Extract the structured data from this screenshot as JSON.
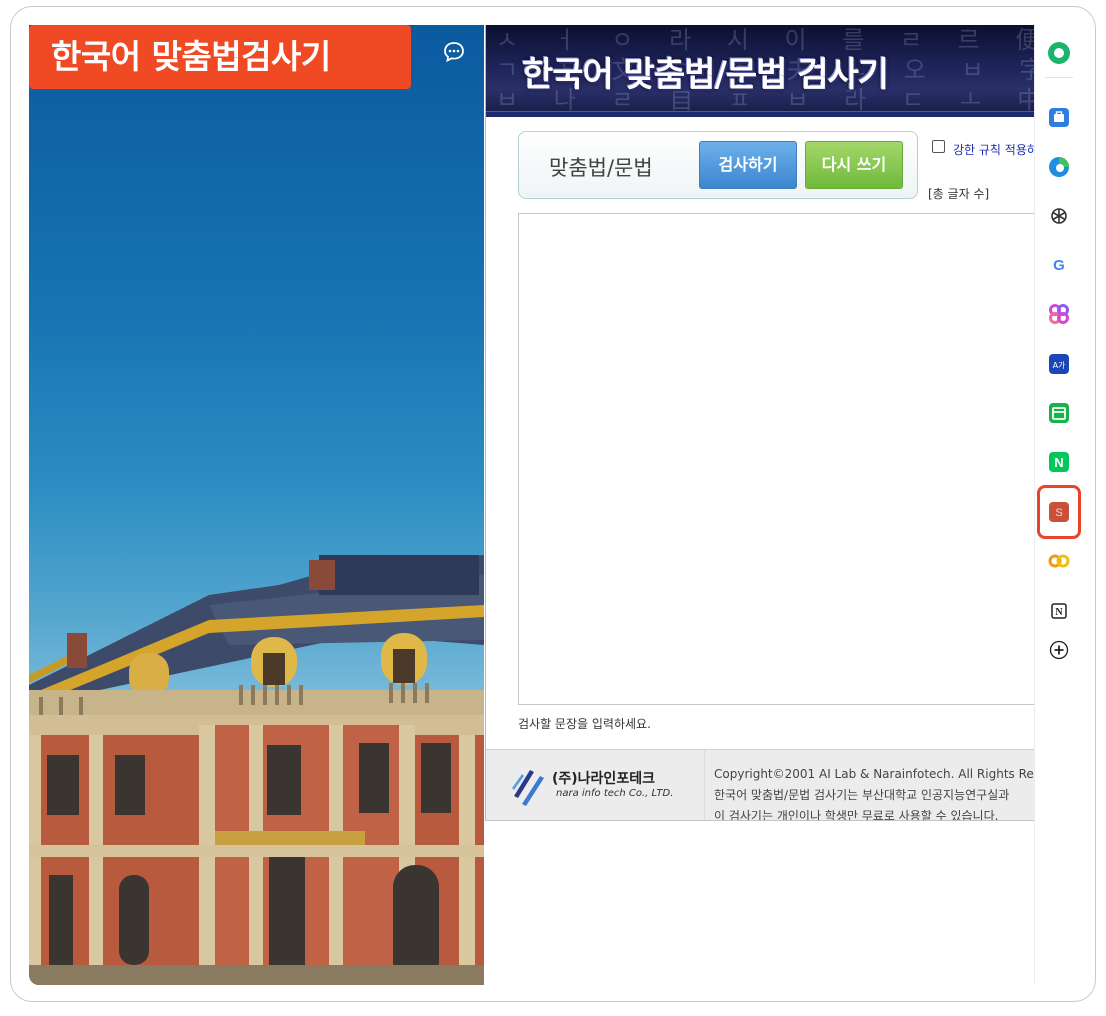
{
  "left_panel": {
    "title": "한국어 맞춤법검사기",
    "chat_icon": "chat-bubble-icon"
  },
  "checker_page": {
    "banner_title": "한국어 맞춤법/문법 검사기",
    "mode_label": "맞춤법/문법",
    "check_button": "검사하기",
    "reset_button": "다시 쓰기",
    "strict_rule_label": "강한 규칙 적용하",
    "char_count_label": "[총 글자 수]",
    "textarea_value": "",
    "input_hint": "검사할 문장을 입력하세요.",
    "footer": {
      "logo_ko": "(주)나라인포테크",
      "logo_en": "nara info tech Co., LTD.",
      "copyright": "Copyright©2001 AI Lab & Narainfotech. All Rights Re",
      "line2": "한국어 맞춤법/문법 검사기는 부산대학교 인공지능연구실과",
      "line3": "이 검사기는 개인이나 학생만 무료로 사용할 수 있습니다."
    }
  },
  "sidebar": {
    "items": [
      {
        "icon": "whale-home-icon",
        "color": "#1ab56b"
      },
      {
        "icon": "briefcase-icon",
        "color": "#2f7de1"
      },
      {
        "icon": "edge-icon",
        "color": "#1f8de0"
      },
      {
        "icon": "openai-icon",
        "color": "#333333"
      },
      {
        "icon": "google-icon",
        "color": "#4285f4"
      },
      {
        "icon": "clover-icon",
        "color": "#d04ad6"
      },
      {
        "icon": "translate-icon",
        "color": "#1a46b8"
      },
      {
        "icon": "calendar-icon",
        "color": "#16b54a"
      },
      {
        "icon": "naver-icon",
        "color": "#03c75a"
      },
      {
        "icon": "spell-checker-icon",
        "color": "#c9513a",
        "label": "S",
        "selected": true
      },
      {
        "icon": "co-icon",
        "color": "#f09a10"
      },
      {
        "icon": "notion-icon",
        "color": "#222222"
      },
      {
        "icon": "add-icon",
        "color": "#222222"
      }
    ]
  },
  "colors": {
    "title_badge": "#ef4a23",
    "selection_outline": "#e8432b",
    "check_button": "#3d86cf",
    "reset_button": "#6fb93c"
  }
}
